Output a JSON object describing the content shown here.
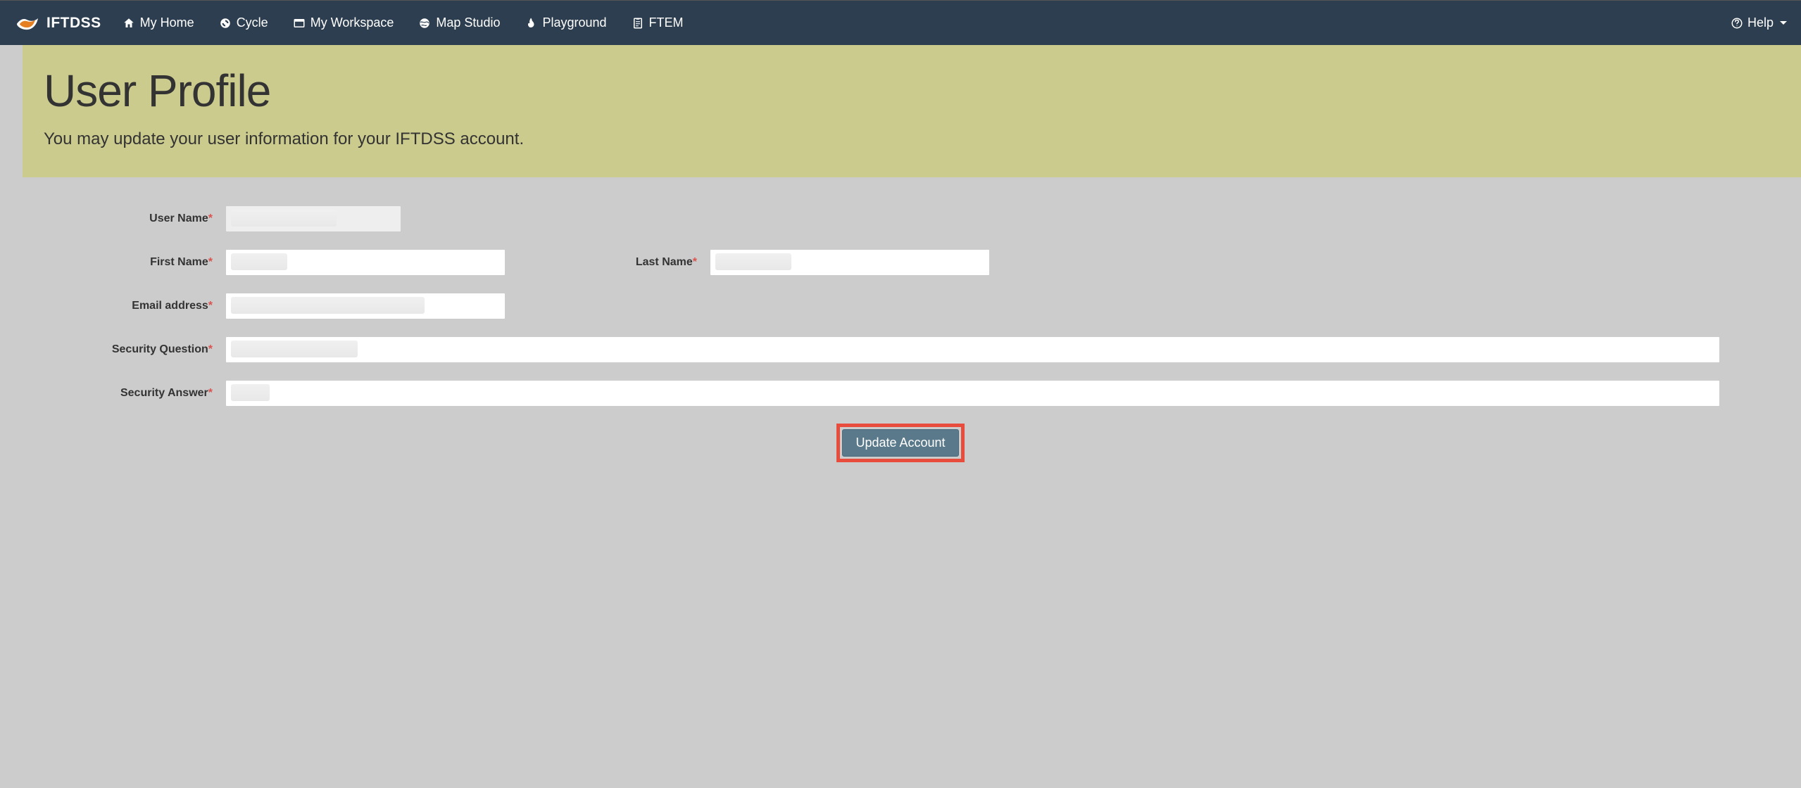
{
  "brand": "IFTDSS",
  "nav": {
    "items": [
      {
        "label": "My Home"
      },
      {
        "label": "Cycle"
      },
      {
        "label": "My Workspace"
      },
      {
        "label": "Map Studio"
      },
      {
        "label": "Playground"
      },
      {
        "label": "FTEM"
      }
    ],
    "help": "Help"
  },
  "hero": {
    "title": "User Profile",
    "subtitle": "You may update your user information for your IFTDSS account."
  },
  "form": {
    "username_label": "User Name",
    "firstname_label": "First Name",
    "lastname_label": "Last Name",
    "email_label": "Email address",
    "security_question_label": "Security Question",
    "security_answer_label": "Security Answer",
    "submit_label": "Update Account"
  }
}
